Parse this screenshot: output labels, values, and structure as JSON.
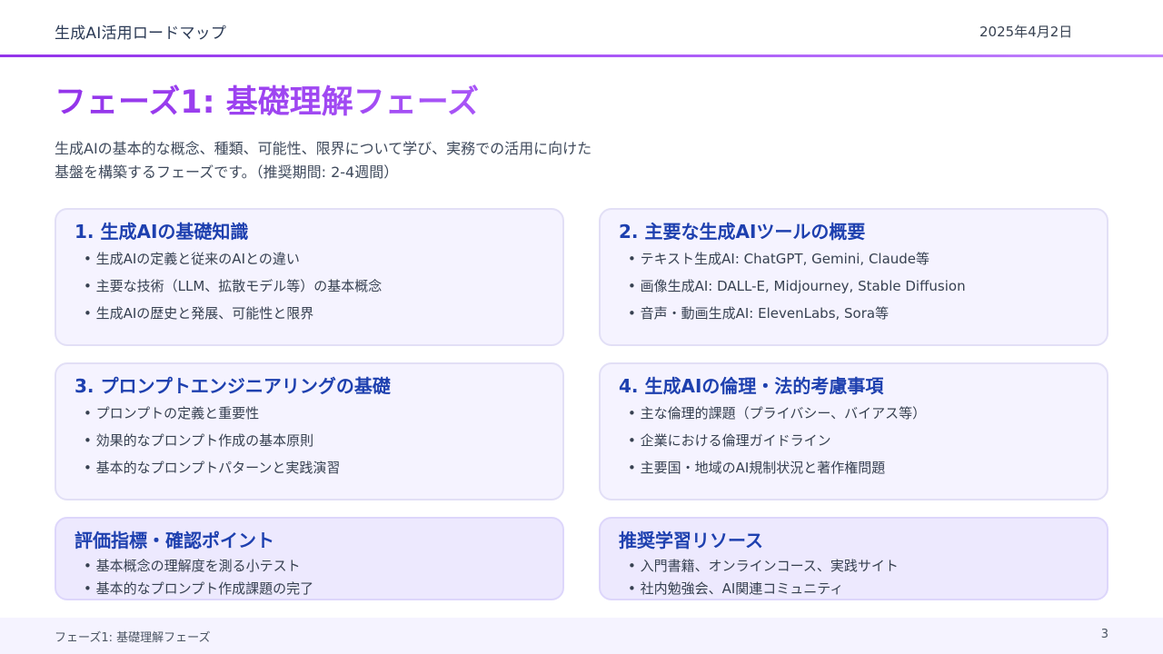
{
  "header": {
    "title": "生成AI活用ロードマップ",
    "date": "2025年4月2日"
  },
  "phase": {
    "title": "フェーズ1: 基礎理解フェーズ",
    "description_line1": "生成AIの基本的な概念、種類、可能性、限界について学び、実務での活用に向けた",
    "description_line2": "基盤を構築するフェーズです。（推奨期間: 2-4週間）"
  },
  "cards": [
    {
      "title": "1. 生成AIの基礎知識",
      "items": [
        "生成AIの定義と従来のAIとの違い",
        "主要な技術（LLM、拡散モデル等）の基本概念",
        "生成AIの歴史と発展、可能性と限界"
      ]
    },
    {
      "title": "2. 主要な生成AIツールの概要",
      "items": [
        "テキスト生成AI: ChatGPT, Gemini, Claude等",
        "画像生成AI: DALL-E, Midjourney, Stable Diffusion",
        "音声・動画生成AI: ElevenLabs, Sora等"
      ]
    },
    {
      "title": "3. プロンプトエンジニアリングの基礎",
      "items": [
        "プロンプトの定義と重要性",
        "効果的なプロンプト作成の基本原則",
        "基本的なプロンプトパターンと実践演習"
      ]
    },
    {
      "title": "4. 生成AIの倫理・法的考慮事項",
      "items": [
        "主な倫理的課題（プライバシー、バイアス等）",
        "企業における倫理ガイドライン",
        "主要国・地域のAI規制状況と著作権問題"
      ]
    },
    {
      "title": "評価指標・確認ポイント",
      "items": [
        "基本概念の理解度を測る小テスト",
        "基本的なプロンプト作成課題の完了"
      ]
    },
    {
      "title": "推奨学習リソース",
      "items": [
        "入門書籍、オンラインコース、実践サイト",
        "社内勉強会、AI関連コミュニティ"
      ]
    }
  ],
  "footer": {
    "text": "フェーズ1: 基礎理解フェーズ",
    "page": "3"
  },
  "colors": {
    "accent": "#9333ea",
    "card_title": "#1e40af",
    "card_bg": "#f5f3ff"
  }
}
